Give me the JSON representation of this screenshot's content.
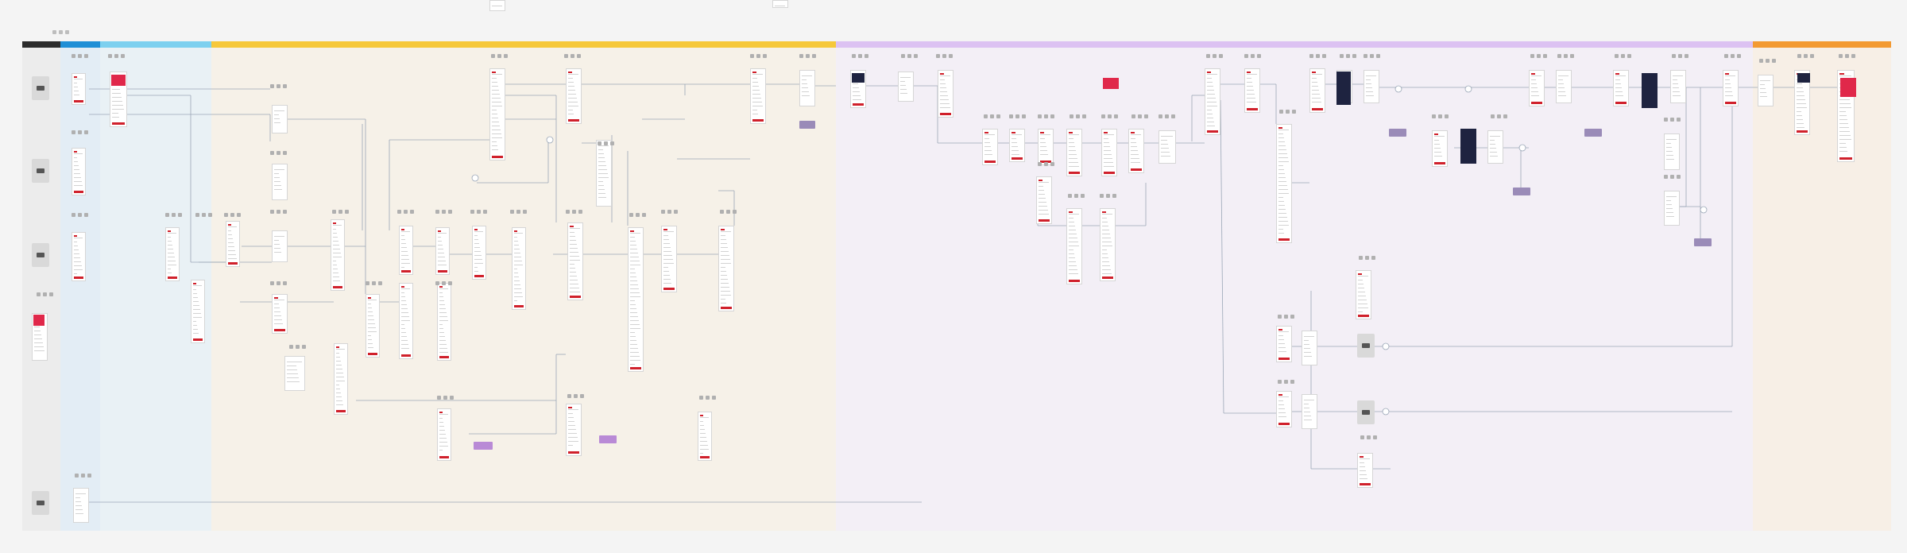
{
  "board": {
    "background": "#f4f4f4",
    "frame_accent": "#d0202b"
  },
  "lanes": [
    {
      "id": "l0",
      "label": "",
      "bg": "#ececec",
      "head": "#2b2b2b"
    },
    {
      "id": "l1",
      "label": "",
      "bg": "#e3edf5",
      "head": "#1f8fd6"
    },
    {
      "id": "l2",
      "label": "",
      "bg": "#e9f1f5",
      "head": "#7dd0ef"
    },
    {
      "id": "l3",
      "label": "",
      "bg": "#f6f1e8",
      "head": "#f6c83a"
    },
    {
      "id": "l4",
      "label": "",
      "bg": "#f3eff6",
      "head": "#dcc2f2"
    },
    {
      "id": "l5",
      "label": "",
      "bg": "#f7efe6",
      "head": "#f39a32"
    }
  ],
  "notes": [
    {
      "id": "n1",
      "label": "",
      "color": "#9a8bb8"
    },
    {
      "id": "n2",
      "label": "",
      "color": "#b98ad6"
    },
    {
      "id": "n3",
      "label": "",
      "color": "#b98ad6"
    },
    {
      "id": "n4",
      "label": "",
      "color": "#9a8bb8"
    },
    {
      "id": "n5",
      "label": "",
      "color": "#9a8bb8"
    },
    {
      "id": "n6",
      "label": "",
      "color": "#9a8bb8"
    },
    {
      "id": "n7",
      "label": "",
      "color": "#9a8bb8"
    }
  ],
  "icons": [
    "app-screen-icon",
    "phone-icon",
    "tablet-icon",
    "device-icon"
  ]
}
